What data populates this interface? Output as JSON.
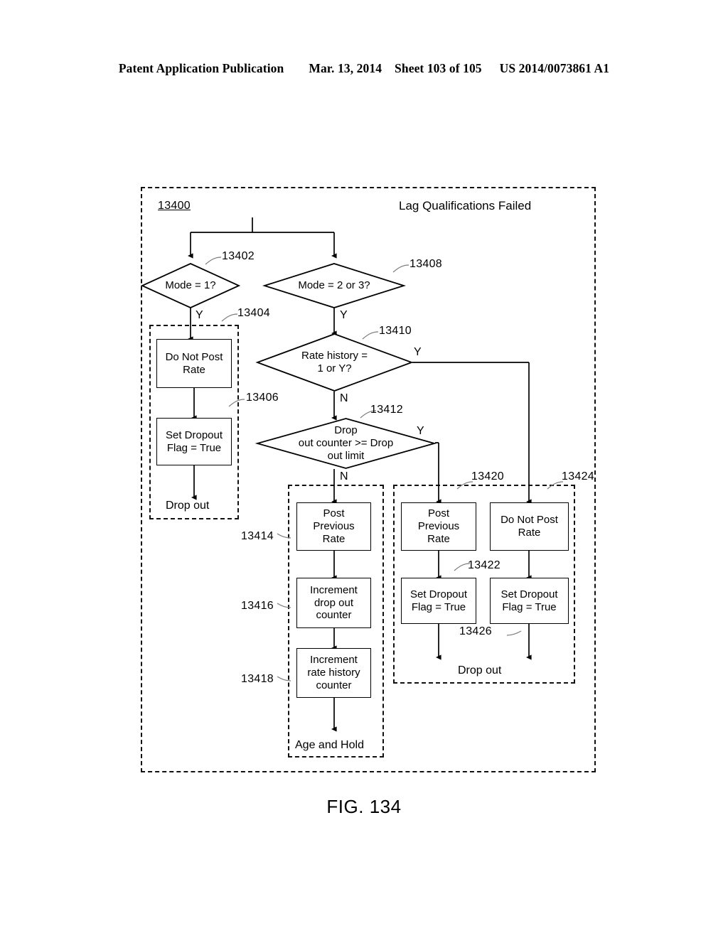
{
  "header": {
    "publication": "Patent Application Publication",
    "date": "Mar. 13, 2014",
    "sheet": "Sheet 103 of 105",
    "docnum": "US 2014/0073861 A1"
  },
  "figure": {
    "caption": "FIG. 134",
    "main_ref": "13400",
    "title": "Lag Qualifications Failed"
  },
  "decisions": {
    "d13402": {
      "ref": "13402",
      "text": "Mode = 1?"
    },
    "d13408": {
      "ref": "13408",
      "text": "Mode = 2 or 3?"
    },
    "d13410": {
      "ref": "13410",
      "line1": "Rate history =",
      "line2": "1 or Y?"
    },
    "d13412": {
      "ref": "13412",
      "line1": "Drop",
      "line2": "out counter >= Drop",
      "line3": "out limit"
    }
  },
  "processes": {
    "p13404": {
      "ref": "13404",
      "line1": "Do Not Post",
      "line2": "Rate"
    },
    "p13406": {
      "ref": "13406",
      "line1": "Set Dropout",
      "line2": "Flag = True"
    },
    "p13414": {
      "ref": "13414",
      "line1": "Post",
      "line2": "Previous",
      "line3": "Rate"
    },
    "p13416": {
      "ref": "13416",
      "line1": "Increment",
      "line2": "drop out",
      "line3": "counter"
    },
    "p13418": {
      "ref": "13418",
      "line1": "Increment",
      "line2": "rate history",
      "line3": "counter"
    },
    "p13420": {
      "ref": "13420",
      "line1": "Post",
      "line2": "Previous",
      "line3": "Rate"
    },
    "p13422": {
      "ref": "13422",
      "line1": "Set Dropout",
      "line2": "Flag = True"
    },
    "p13424": {
      "ref": "13424",
      "line1": "Do Not Post",
      "line2": "Rate"
    },
    "p13426": {
      "ref": "13426",
      "line1": "Set Dropout",
      "line2": "Flag = True"
    }
  },
  "branch_labels": {
    "y1": "Y",
    "y2": "Y",
    "y3": "Y",
    "y4": "Y",
    "n1": "N",
    "n2": "N"
  },
  "terminals": {
    "dropout_left": "Drop out",
    "age_and_hold": "Age and Hold",
    "dropout_right": "Drop out"
  }
}
